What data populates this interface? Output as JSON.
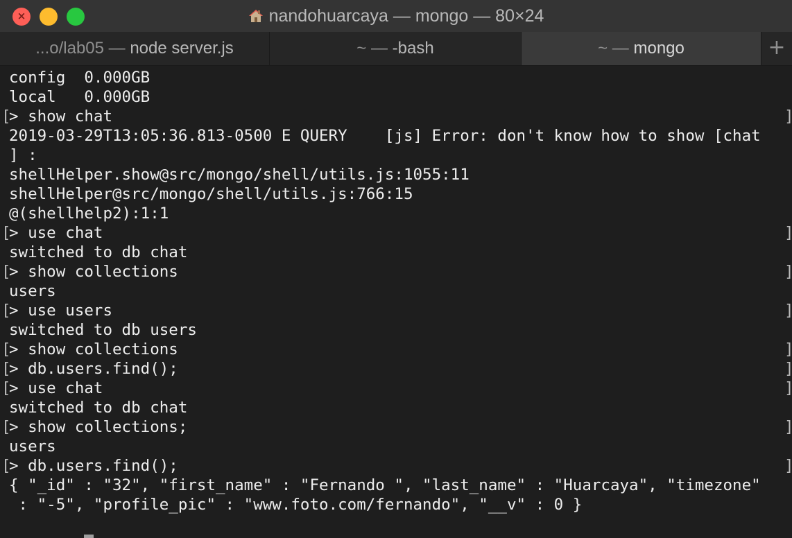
{
  "window": {
    "title": "nandohuarcaya — mongo — 80×24"
  },
  "tabs": [
    {
      "dim": "...o/lab05 — ",
      "main": "node server.js"
    },
    {
      "dim": "~ — ",
      "main": "-bash"
    },
    {
      "dim": "~ — ",
      "main": "mongo"
    }
  ],
  "tab_add_label": "+",
  "terminal": {
    "lines": [
      {
        "text": "config  0.000GB",
        "prompt": false
      },
      {
        "text": "local   0.000GB",
        "prompt": false
      },
      {
        "text": "> show chat",
        "prompt": true
      },
      {
        "text": "2019-03-29T13:05:36.813-0500 E QUERY    [js] Error: don't know how to show [chat",
        "prompt": false
      },
      {
        "text": "] :",
        "prompt": false
      },
      {
        "text": "shellHelper.show@src/mongo/shell/utils.js:1055:11",
        "prompt": false
      },
      {
        "text": "shellHelper@src/mongo/shell/utils.js:766:15",
        "prompt": false
      },
      {
        "text": "@(shellhelp2):1:1",
        "prompt": false
      },
      {
        "text": "> use chat",
        "prompt": true
      },
      {
        "text": "switched to db chat",
        "prompt": false
      },
      {
        "text": "> show collections",
        "prompt": true
      },
      {
        "text": "users",
        "prompt": false
      },
      {
        "text": "> use users",
        "prompt": true
      },
      {
        "text": "switched to db users",
        "prompt": false
      },
      {
        "text": "> show collections",
        "prompt": true
      },
      {
        "text": "> db.users.find();",
        "prompt": true
      },
      {
        "text": "> use chat",
        "prompt": true
      },
      {
        "text": "switched to db chat",
        "prompt": false
      },
      {
        "text": "> show collections;",
        "prompt": true
      },
      {
        "text": "users",
        "prompt": false
      },
      {
        "text": "> db.users.find();",
        "prompt": true
      },
      {
        "text": "{ \"_id\" : \"32\", \"first_name\" : \"Fernando \", \"last_name\" : \"Huarcaya\", \"timezone\"",
        "prompt": false
      },
      {
        "text": " : \"-5\", \"profile_pic\" : \"www.foto.com/fernando\", \"__v\" : 0 }",
        "prompt": false
      }
    ],
    "current_prompt": ">",
    "mark_left": "[",
    "mark_right": "]"
  },
  "colors": {
    "close": "#fe5f57",
    "minimize": "#febc2e",
    "maximize": "#28c840",
    "background": "#1e1e1e",
    "foreground": "#ededed"
  }
}
